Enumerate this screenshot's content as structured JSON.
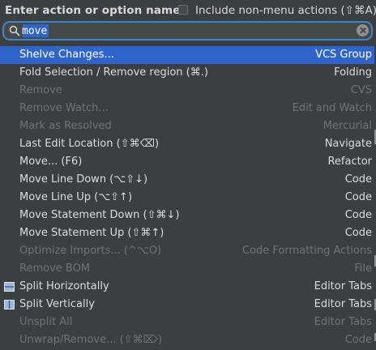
{
  "header": {
    "title": "Enter action or option name:",
    "checkbox_label": "Include non-menu actions (⇧⌘A)",
    "checkbox_checked": false
  },
  "search": {
    "value": "move",
    "search_icon": "magnifier-icon",
    "clear_icon": "clear-circle-icon"
  },
  "colors": {
    "background": "#3c3f41",
    "selection": "#2f65ca",
    "focus_border": "#3e86c6",
    "disabled_text": "#6f7376"
  },
  "results": [
    {
      "label": "Shelve Changes...",
      "group": "VCS Group",
      "selected": true,
      "disabled": false,
      "icon": ""
    },
    {
      "label": "Fold Selection / Remove region (⌘.)",
      "group": "Folding",
      "selected": false,
      "disabled": false,
      "icon": ""
    },
    {
      "label": "Remove",
      "group": "CVS",
      "selected": false,
      "disabled": true,
      "icon": ""
    },
    {
      "label": "Remove Watch...",
      "group": "Edit and Watch",
      "selected": false,
      "disabled": true,
      "icon": ""
    },
    {
      "label": "Mark as Resolved",
      "group": "Mercurial",
      "selected": false,
      "disabled": true,
      "icon": ""
    },
    {
      "label": "Last Edit Location (⇧⌘⌫)",
      "group": "Navigate",
      "selected": false,
      "disabled": false,
      "icon": ""
    },
    {
      "label": "Move... (F6)",
      "group": "Refactor",
      "selected": false,
      "disabled": false,
      "icon": ""
    },
    {
      "label": "Move Line Down (⌥⇧↓)",
      "group": "Code",
      "selected": false,
      "disabled": false,
      "icon": ""
    },
    {
      "label": "Move Line Up (⌥⇧↑)",
      "group": "Code",
      "selected": false,
      "disabled": false,
      "icon": ""
    },
    {
      "label": "Move Statement Down (⇧⌘↓)",
      "group": "Code",
      "selected": false,
      "disabled": false,
      "icon": ""
    },
    {
      "label": "Move Statement Up (⇧⌘↑)",
      "group": "Code",
      "selected": false,
      "disabled": false,
      "icon": ""
    },
    {
      "label": "Optimize Imports... (^⌥O)",
      "group": "Code Formatting Actions",
      "selected": false,
      "disabled": true,
      "icon": ""
    },
    {
      "label": "Remove BOM",
      "group": "File",
      "selected": false,
      "disabled": true,
      "icon": ""
    },
    {
      "label": "Split Horizontally",
      "group": "Editor Tabs",
      "selected": false,
      "disabled": false,
      "icon": "split-horizontal-icon"
    },
    {
      "label": "Split Vertically",
      "group": "Editor Tabs",
      "selected": false,
      "disabled": false,
      "icon": "split-vertical-icon"
    },
    {
      "label": "Unsplit All",
      "group": "Editor Tabs",
      "selected": false,
      "disabled": true,
      "icon": ""
    },
    {
      "label": "Unwrap/Remove... (⇧⌘⌦)",
      "group": "Code",
      "selected": false,
      "disabled": true,
      "icon": ""
    }
  ]
}
